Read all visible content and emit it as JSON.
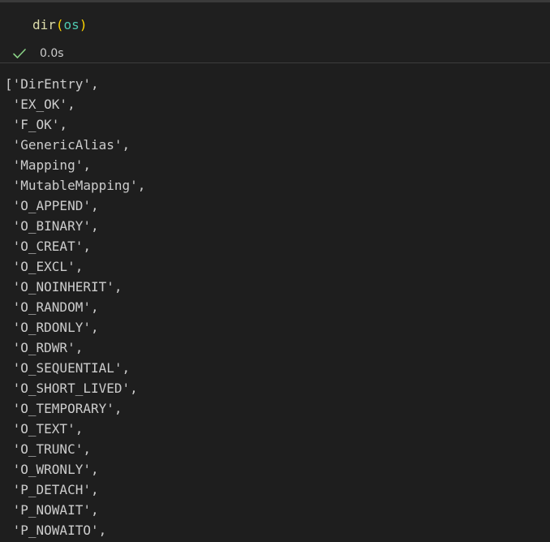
{
  "code": {
    "fn": "dir",
    "open_paren": "(",
    "arg": "os",
    "close_paren": ")"
  },
  "status": {
    "icon": "check-icon",
    "icon_color": "#89d185",
    "time": "0.0s"
  },
  "output": {
    "lines": [
      "['DirEntry',",
      " 'EX_OK',",
      " 'F_OK',",
      " 'GenericAlias',",
      " 'Mapping',",
      " 'MutableMapping',",
      " 'O_APPEND',",
      " 'O_BINARY',",
      " 'O_CREAT',",
      " 'O_EXCL',",
      " 'O_NOINHERIT',",
      " 'O_RANDOM',",
      " 'O_RDONLY',",
      " 'O_RDWR',",
      " 'O_SEQUENTIAL',",
      " 'O_SHORT_LIVED',",
      " 'O_TEMPORARY',",
      " 'O_TEXT',",
      " 'O_TRUNC',",
      " 'O_WRONLY',",
      " 'P_DETACH',",
      " 'P_NOWAIT',",
      " 'P_NOWAITO',"
    ]
  }
}
